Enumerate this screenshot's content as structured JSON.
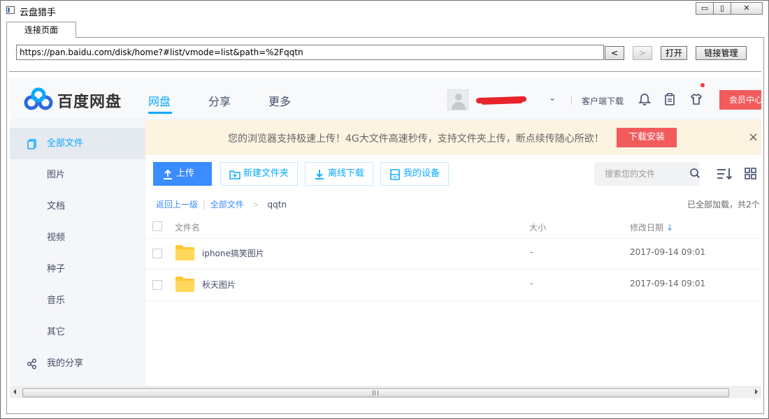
{
  "window": {
    "title": "云盘猎手",
    "minimize_glyph": "▭",
    "maximize_glyph": "▯",
    "close_glyph": "✕"
  },
  "tab": {
    "label": "连接页面"
  },
  "address": {
    "url": "https://pan.baidu.com/disk/home?#list/vmode=list&path=%2Fqqtn",
    "back_label": "<",
    "forward_label": ">",
    "open_label": "打开",
    "links_label": "链接管理"
  },
  "site": {
    "brand": "百度网盘",
    "nav": [
      {
        "label": "网盘",
        "active": true
      },
      {
        "label": "分享",
        "active": false
      },
      {
        "label": "更多",
        "active": false
      }
    ],
    "client_download": "客户端下载",
    "vip_label": "会员中心",
    "accent_color": "#09aaff",
    "red_color": "#f25b5b"
  },
  "sidebar": {
    "items": [
      {
        "label": "全部文件",
        "icon": "files-icon",
        "active": true
      },
      {
        "label": "图片"
      },
      {
        "label": "文档"
      },
      {
        "label": "视频"
      },
      {
        "label": "种子"
      },
      {
        "label": "音乐"
      },
      {
        "label": "其它"
      },
      {
        "label": "我的分享",
        "icon": "share-icon"
      }
    ]
  },
  "banner": {
    "text": "您的浏览器支持极速上传！4G大文件高速秒传，支持文件夹上传，断点续传随心所欲！",
    "button": "下载安装",
    "close_glyph": "×"
  },
  "toolbar": {
    "upload": "上传",
    "new_folder": "新建文件夹",
    "offline_download": "离线下载",
    "my_devices": "我的设备",
    "search_placeholder": "搜索您的文件"
  },
  "breadcrumb": {
    "back": "返回上一级",
    "divider": "|",
    "all_files": "全部文件",
    "arrow": ">",
    "current": "qqtn"
  },
  "loaded_info": "已全部加载，共2个",
  "table": {
    "headers": {
      "name": "文件名",
      "size": "大小",
      "modified": "修改日期",
      "sort_glyph": "↓"
    },
    "rows": [
      {
        "name": "iphone搞笑图片",
        "size": "-",
        "modified": "2017-09-14 09:01"
      },
      {
        "name": "秋天图片",
        "size": "-",
        "modified": "2017-09-14 09:01"
      }
    ]
  },
  "user": {
    "chevron": "⌄"
  }
}
